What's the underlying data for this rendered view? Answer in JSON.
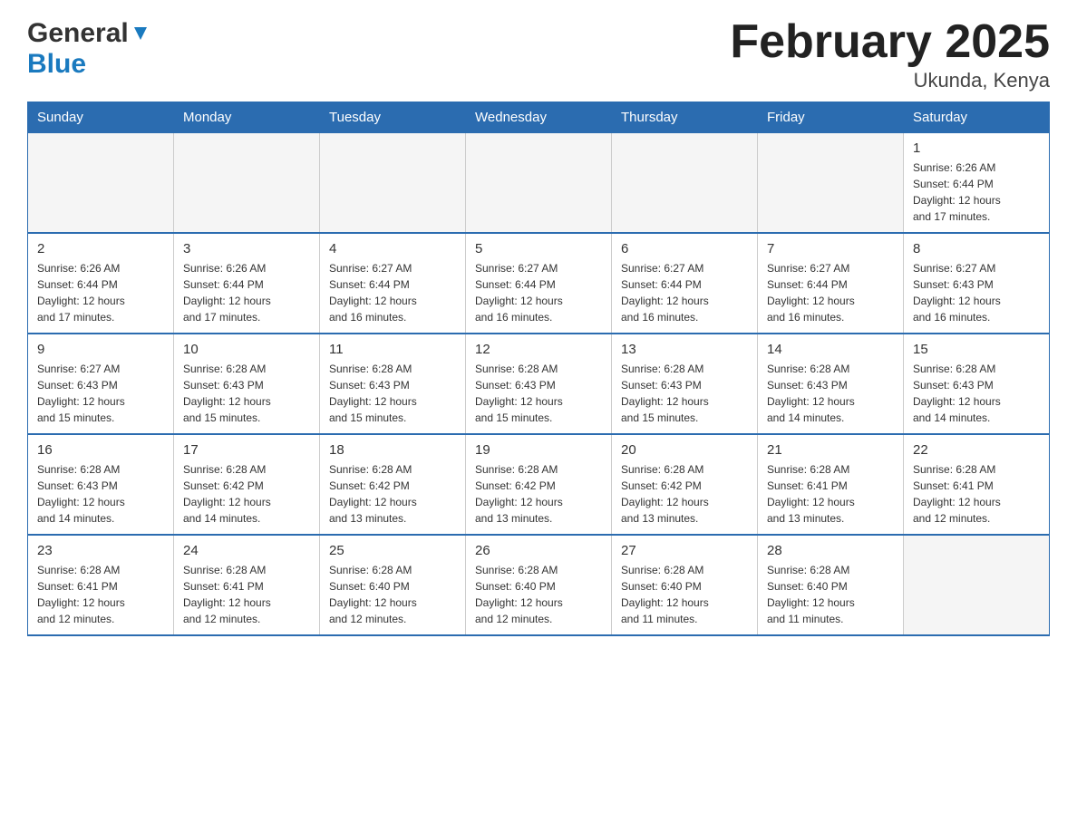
{
  "header": {
    "logo_general": "General",
    "logo_blue": "Blue",
    "month_title": "February 2025",
    "location": "Ukunda, Kenya"
  },
  "days_of_week": [
    "Sunday",
    "Monday",
    "Tuesday",
    "Wednesday",
    "Thursday",
    "Friday",
    "Saturday"
  ],
  "weeks": [
    {
      "days": [
        {
          "num": "",
          "info": "",
          "empty": true
        },
        {
          "num": "",
          "info": "",
          "empty": true
        },
        {
          "num": "",
          "info": "",
          "empty": true
        },
        {
          "num": "",
          "info": "",
          "empty": true
        },
        {
          "num": "",
          "info": "",
          "empty": true
        },
        {
          "num": "",
          "info": "",
          "empty": true
        },
        {
          "num": "1",
          "info": "Sunrise: 6:26 AM\nSunset: 6:44 PM\nDaylight: 12 hours\nand 17 minutes.",
          "empty": false
        }
      ]
    },
    {
      "days": [
        {
          "num": "2",
          "info": "Sunrise: 6:26 AM\nSunset: 6:44 PM\nDaylight: 12 hours\nand 17 minutes.",
          "empty": false
        },
        {
          "num": "3",
          "info": "Sunrise: 6:26 AM\nSunset: 6:44 PM\nDaylight: 12 hours\nand 17 minutes.",
          "empty": false
        },
        {
          "num": "4",
          "info": "Sunrise: 6:27 AM\nSunset: 6:44 PM\nDaylight: 12 hours\nand 16 minutes.",
          "empty": false
        },
        {
          "num": "5",
          "info": "Sunrise: 6:27 AM\nSunset: 6:44 PM\nDaylight: 12 hours\nand 16 minutes.",
          "empty": false
        },
        {
          "num": "6",
          "info": "Sunrise: 6:27 AM\nSunset: 6:44 PM\nDaylight: 12 hours\nand 16 minutes.",
          "empty": false
        },
        {
          "num": "7",
          "info": "Sunrise: 6:27 AM\nSunset: 6:44 PM\nDaylight: 12 hours\nand 16 minutes.",
          "empty": false
        },
        {
          "num": "8",
          "info": "Sunrise: 6:27 AM\nSunset: 6:43 PM\nDaylight: 12 hours\nand 16 minutes.",
          "empty": false
        }
      ]
    },
    {
      "days": [
        {
          "num": "9",
          "info": "Sunrise: 6:27 AM\nSunset: 6:43 PM\nDaylight: 12 hours\nand 15 minutes.",
          "empty": false
        },
        {
          "num": "10",
          "info": "Sunrise: 6:28 AM\nSunset: 6:43 PM\nDaylight: 12 hours\nand 15 minutes.",
          "empty": false
        },
        {
          "num": "11",
          "info": "Sunrise: 6:28 AM\nSunset: 6:43 PM\nDaylight: 12 hours\nand 15 minutes.",
          "empty": false
        },
        {
          "num": "12",
          "info": "Sunrise: 6:28 AM\nSunset: 6:43 PM\nDaylight: 12 hours\nand 15 minutes.",
          "empty": false
        },
        {
          "num": "13",
          "info": "Sunrise: 6:28 AM\nSunset: 6:43 PM\nDaylight: 12 hours\nand 15 minutes.",
          "empty": false
        },
        {
          "num": "14",
          "info": "Sunrise: 6:28 AM\nSunset: 6:43 PM\nDaylight: 12 hours\nand 14 minutes.",
          "empty": false
        },
        {
          "num": "15",
          "info": "Sunrise: 6:28 AM\nSunset: 6:43 PM\nDaylight: 12 hours\nand 14 minutes.",
          "empty": false
        }
      ]
    },
    {
      "days": [
        {
          "num": "16",
          "info": "Sunrise: 6:28 AM\nSunset: 6:43 PM\nDaylight: 12 hours\nand 14 minutes.",
          "empty": false
        },
        {
          "num": "17",
          "info": "Sunrise: 6:28 AM\nSunset: 6:42 PM\nDaylight: 12 hours\nand 14 minutes.",
          "empty": false
        },
        {
          "num": "18",
          "info": "Sunrise: 6:28 AM\nSunset: 6:42 PM\nDaylight: 12 hours\nand 13 minutes.",
          "empty": false
        },
        {
          "num": "19",
          "info": "Sunrise: 6:28 AM\nSunset: 6:42 PM\nDaylight: 12 hours\nand 13 minutes.",
          "empty": false
        },
        {
          "num": "20",
          "info": "Sunrise: 6:28 AM\nSunset: 6:42 PM\nDaylight: 12 hours\nand 13 minutes.",
          "empty": false
        },
        {
          "num": "21",
          "info": "Sunrise: 6:28 AM\nSunset: 6:41 PM\nDaylight: 12 hours\nand 13 minutes.",
          "empty": false
        },
        {
          "num": "22",
          "info": "Sunrise: 6:28 AM\nSunset: 6:41 PM\nDaylight: 12 hours\nand 12 minutes.",
          "empty": false
        }
      ]
    },
    {
      "days": [
        {
          "num": "23",
          "info": "Sunrise: 6:28 AM\nSunset: 6:41 PM\nDaylight: 12 hours\nand 12 minutes.",
          "empty": false
        },
        {
          "num": "24",
          "info": "Sunrise: 6:28 AM\nSunset: 6:41 PM\nDaylight: 12 hours\nand 12 minutes.",
          "empty": false
        },
        {
          "num": "25",
          "info": "Sunrise: 6:28 AM\nSunset: 6:40 PM\nDaylight: 12 hours\nand 12 minutes.",
          "empty": false
        },
        {
          "num": "26",
          "info": "Sunrise: 6:28 AM\nSunset: 6:40 PM\nDaylight: 12 hours\nand 12 minutes.",
          "empty": false
        },
        {
          "num": "27",
          "info": "Sunrise: 6:28 AM\nSunset: 6:40 PM\nDaylight: 12 hours\nand 11 minutes.",
          "empty": false
        },
        {
          "num": "28",
          "info": "Sunrise: 6:28 AM\nSunset: 6:40 PM\nDaylight: 12 hours\nand 11 minutes.",
          "empty": false
        },
        {
          "num": "",
          "info": "",
          "empty": true
        }
      ]
    }
  ]
}
